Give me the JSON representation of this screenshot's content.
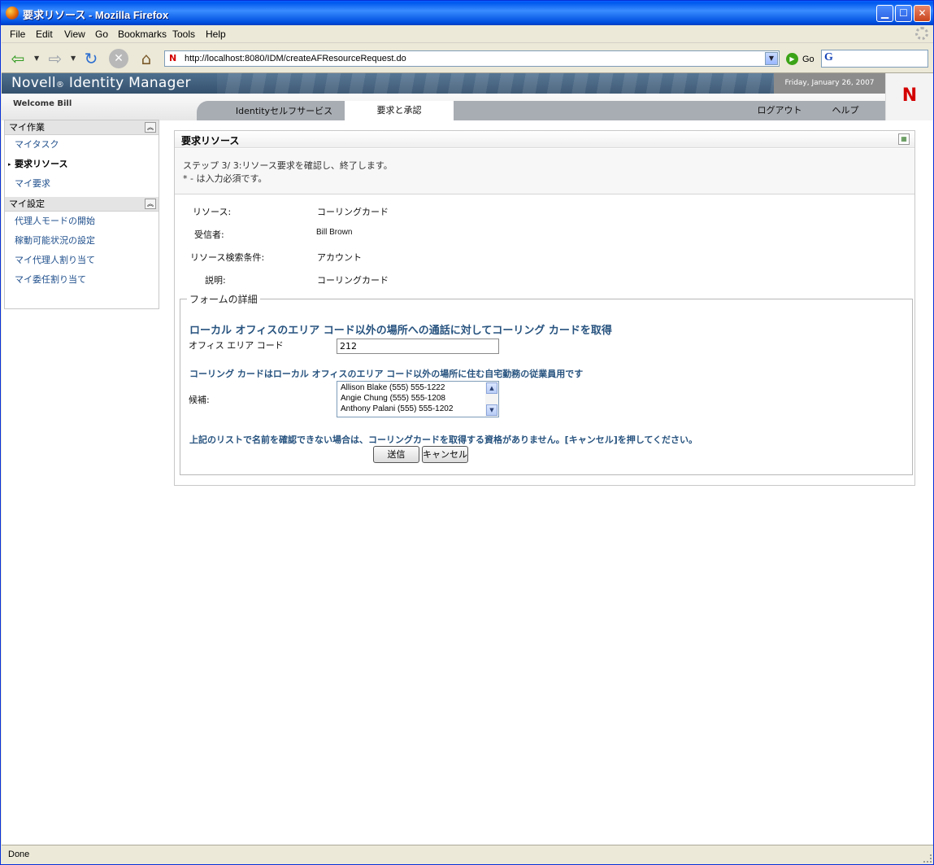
{
  "window": {
    "title": "要求リソース - Mozilla Firefox",
    "min_glyph": "▁",
    "max_glyph": "☐",
    "close_glyph": "✕"
  },
  "menu": [
    "File",
    "Edit",
    "View",
    "Go",
    "Bookmarks",
    "Tools",
    "Help"
  ],
  "toolbar": {
    "back_glyph": "⇦",
    "forward_glyph": "⇨",
    "reload_glyph": "↻",
    "stop_glyph": "✕",
    "home_glyph": "⌂",
    "dropdown_glyph": "▼",
    "url": "http://localhost:8080/IDM/createAFResourceRequest.do",
    "favicon": "N",
    "go_label": "Go",
    "go_glyph": "▶",
    "search_logo": "G"
  },
  "header": {
    "brand": "Novell",
    "brand_mark": "®",
    "brand_product": " Identity Manager",
    "date": "Friday, January 26, 2007",
    "logo": "N",
    "welcome": "Welcome Bill"
  },
  "tabs": {
    "self_service": "Identityセルフサービス",
    "requests": "要求と承認",
    "logout": "ログアウト",
    "help": "ヘルプ"
  },
  "sidebar": {
    "collapse_glyph": "︽",
    "bullet": "▸",
    "my_work": {
      "title": "マイ作業",
      "items": [
        "マイタスク",
        "要求リソース",
        "マイ要求"
      ]
    },
    "my_settings": {
      "title": "マイ設定",
      "items": [
        "代理人モードの開始",
        "稼動可能状況の設定",
        "マイ代理人割り当て",
        "マイ委任割り当て"
      ]
    }
  },
  "panel": {
    "title": "要求リソース",
    "grid_glyph": "▦",
    "step": "ステップ 3/ 3:リソース要求を確認し、終了します。",
    "required_note": "* - は入力必須です。",
    "fields": [
      {
        "label": "リソース:",
        "value": "コーリングカード"
      },
      {
        "label": "受信者:",
        "value": "Bill Brown"
      },
      {
        "label": "リソース検索条件:",
        "value": "アカウント"
      },
      {
        "label": "説明:",
        "value": "コーリングカード"
      }
    ]
  },
  "form": {
    "legend": "フォームの詳細",
    "heading": "ローカル オフィスのエリア コード以外の場所への通話に対してコーリング カードを取得",
    "area_code_label": "オフィス エリア コード",
    "area_code_value": "212",
    "description": "コーリング カードはローカル オフィスのエリア コード以外の場所に住む自宅勤務の従業員用です",
    "candidates_label": "候補:",
    "candidates": [
      "Allison Blake (555) 555-1222",
      "Angie Chung (555) 555-1208",
      "Anthony Palani (555) 555-1202"
    ],
    "scroll_up_glyph": "▲",
    "scroll_down_glyph": "▼",
    "note": "上記のリストで名前を確認できない場合は、コーリングカードを取得する資格がありません。[キャンセル]を押してください。",
    "submit": "送信",
    "cancel": "キャンセル"
  },
  "status": "Done"
}
